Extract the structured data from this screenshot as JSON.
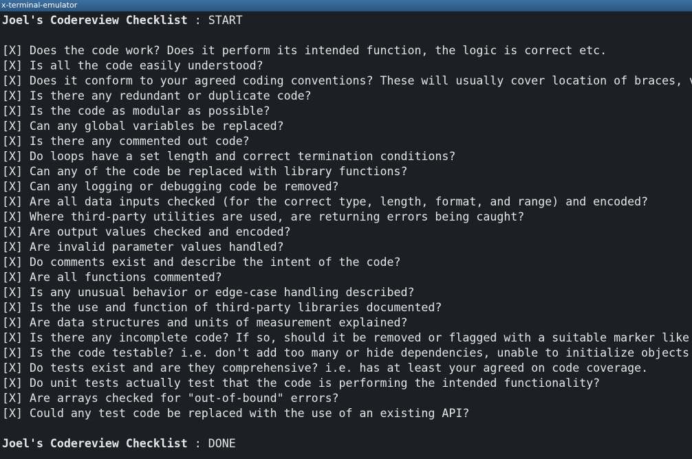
{
  "window": {
    "title": "x-terminal-emulator"
  },
  "terminal": {
    "header": {
      "name": "Joel's Codereview Checklist",
      "separator": " : ",
      "status": "START"
    },
    "items": [
      {
        "mark": "[X]",
        "text": "Does the code work? Does it perform its intended function, the logic is correct etc."
      },
      {
        "mark": "[X]",
        "text": "Is all the code easily understood?"
      },
      {
        "mark": "[X]",
        "text": "Does it conform to your agreed coding conventions? These will usually cover location of braces, v"
      },
      {
        "mark": "[X]",
        "text": "Is there any redundant or duplicate code?"
      },
      {
        "mark": "[X]",
        "text": "Is the code as modular as possible?"
      },
      {
        "mark": "[X]",
        "text": "Can any global variables be replaced?"
      },
      {
        "mark": "[X]",
        "text": "Is there any commented out code?"
      },
      {
        "mark": "[X]",
        "text": "Do loops have a set length and correct termination conditions?"
      },
      {
        "mark": "[X]",
        "text": "Can any of the code be replaced with library functions?"
      },
      {
        "mark": "[X]",
        "text": "Can any logging or debugging code be removed?"
      },
      {
        "mark": "[X]",
        "text": "Are all data inputs checked (for the correct type, length, format, and range) and encoded?"
      },
      {
        "mark": "[X]",
        "text": "Where third-party utilities are used, are returning errors being caught?"
      },
      {
        "mark": "[X]",
        "text": "Are output values checked and encoded?"
      },
      {
        "mark": "[X]",
        "text": "Are invalid parameter values handled?"
      },
      {
        "mark": "[X]",
        "text": "Do comments exist and describe the intent of the code?"
      },
      {
        "mark": "[X]",
        "text": "Are all functions commented?"
      },
      {
        "mark": "[X]",
        "text": "Is any unusual behavior or edge-case handling described?"
      },
      {
        "mark": "[X]",
        "text": "Is the use and function of third-party libraries documented?"
      },
      {
        "mark": "[X]",
        "text": "Are data structures and units of measurement explained?"
      },
      {
        "mark": "[X]",
        "text": "Is there any incomplete code? If so, should it be removed or flagged with a suitable marker like"
      },
      {
        "mark": "[X]",
        "text": "Is the code testable? i.e. don't add too many or hide dependencies, unable to initialize objects"
      },
      {
        "mark": "[X]",
        "text": "Do tests exist and are they comprehensive? i.e. has at least your agreed on code coverage."
      },
      {
        "mark": "[X]",
        "text": "Do unit tests actually test that the code is performing the intended functionality?"
      },
      {
        "mark": "[X]",
        "text": "Are arrays checked for \"out-of-bound\" errors?"
      },
      {
        "mark": "[X]",
        "text": "Could any test code be replaced with the use of an existing API?"
      }
    ],
    "footer": {
      "name": "Joel's Codereview Checklist",
      "separator": " : ",
      "status": "DONE"
    }
  }
}
